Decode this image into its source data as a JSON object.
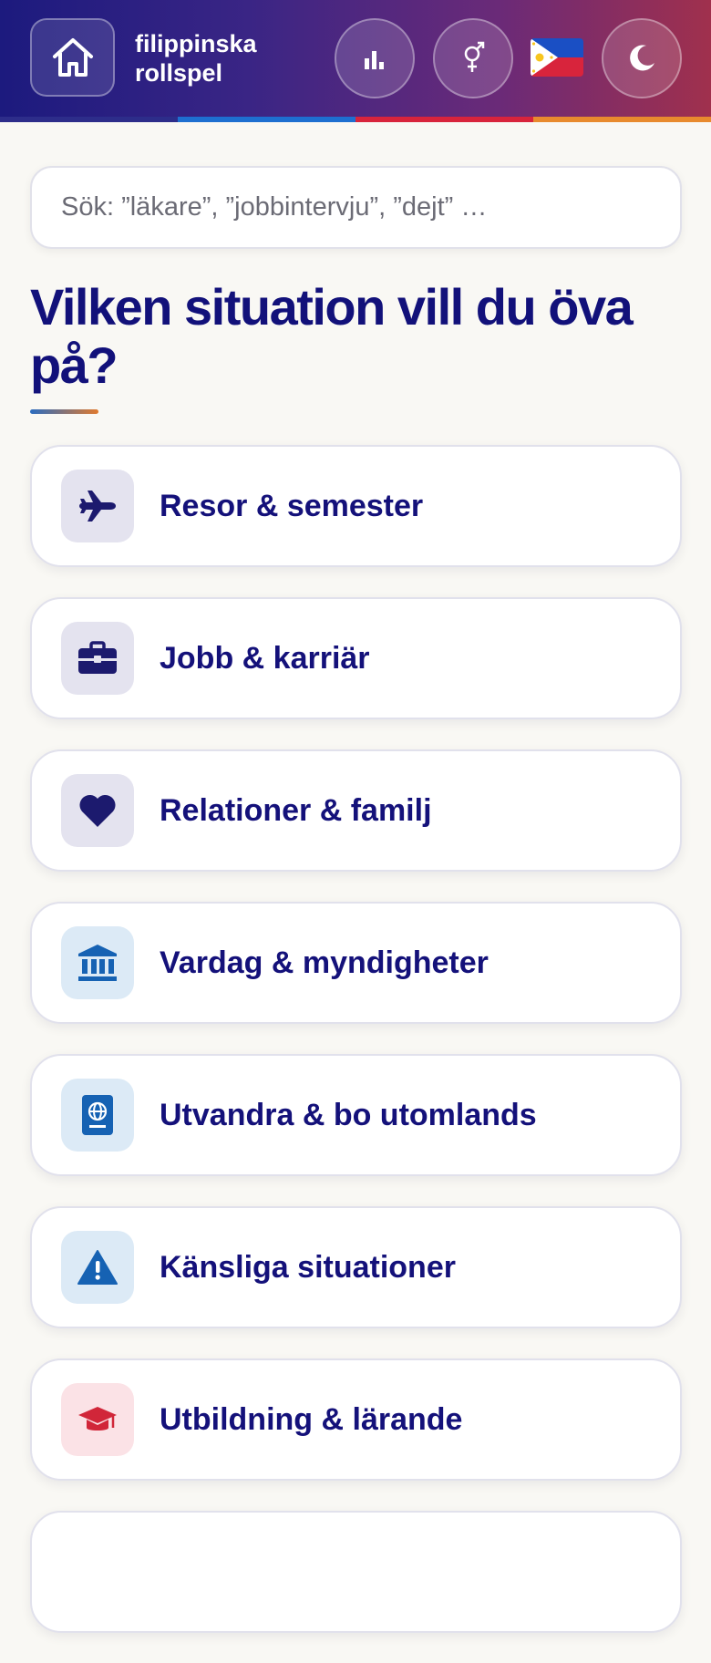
{
  "header": {
    "brand_line1": "filippinska",
    "brand_line2": "rollspel",
    "buttons": [
      "home-icon",
      "bar-chart-icon",
      "gender-icon",
      "philippines-flag",
      "moon-icon"
    ],
    "stripe_colors": [
      "#2d2d8a",
      "#1e6fd0",
      "#d8243c",
      "#e88a2e"
    ]
  },
  "search": {
    "placeholder": "Sök: ”läkare”, ”jobbintervju”, ”dejt” …"
  },
  "main": {
    "title": "Vilken situation vill du öva på?",
    "categories": [
      {
        "label": "Resor & semester",
        "icon": "airplane-icon",
        "bg": "#e4e3ef",
        "color": "#1c1a6e"
      },
      {
        "label": "Jobb & karriär",
        "icon": "briefcase-icon",
        "bg": "#e4e3ef",
        "color": "#1c1a6e"
      },
      {
        "label": "Relationer & familj",
        "icon": "heart-icon",
        "bg": "#e4e3ef",
        "color": "#1c1a6e"
      },
      {
        "label": "Vardag & myndigheter",
        "icon": "bank-icon",
        "bg": "#dceaf6",
        "color": "#1662b3"
      },
      {
        "label": "Utvandra & bo utomlands",
        "icon": "passport-icon",
        "bg": "#dceaf6",
        "color": "#1662b3"
      },
      {
        "label": "Känsliga situationer",
        "icon": "warning-icon",
        "bg": "#dceaf6",
        "color": "#1662b3"
      },
      {
        "label": "Utbildning & lärande",
        "icon": "graduation-cap-icon",
        "bg": "#fbe2e6",
        "color": "#d12639"
      },
      {
        "label": "",
        "icon": "",
        "bg": "#ffffff",
        "color": "#ffffff"
      }
    ]
  }
}
